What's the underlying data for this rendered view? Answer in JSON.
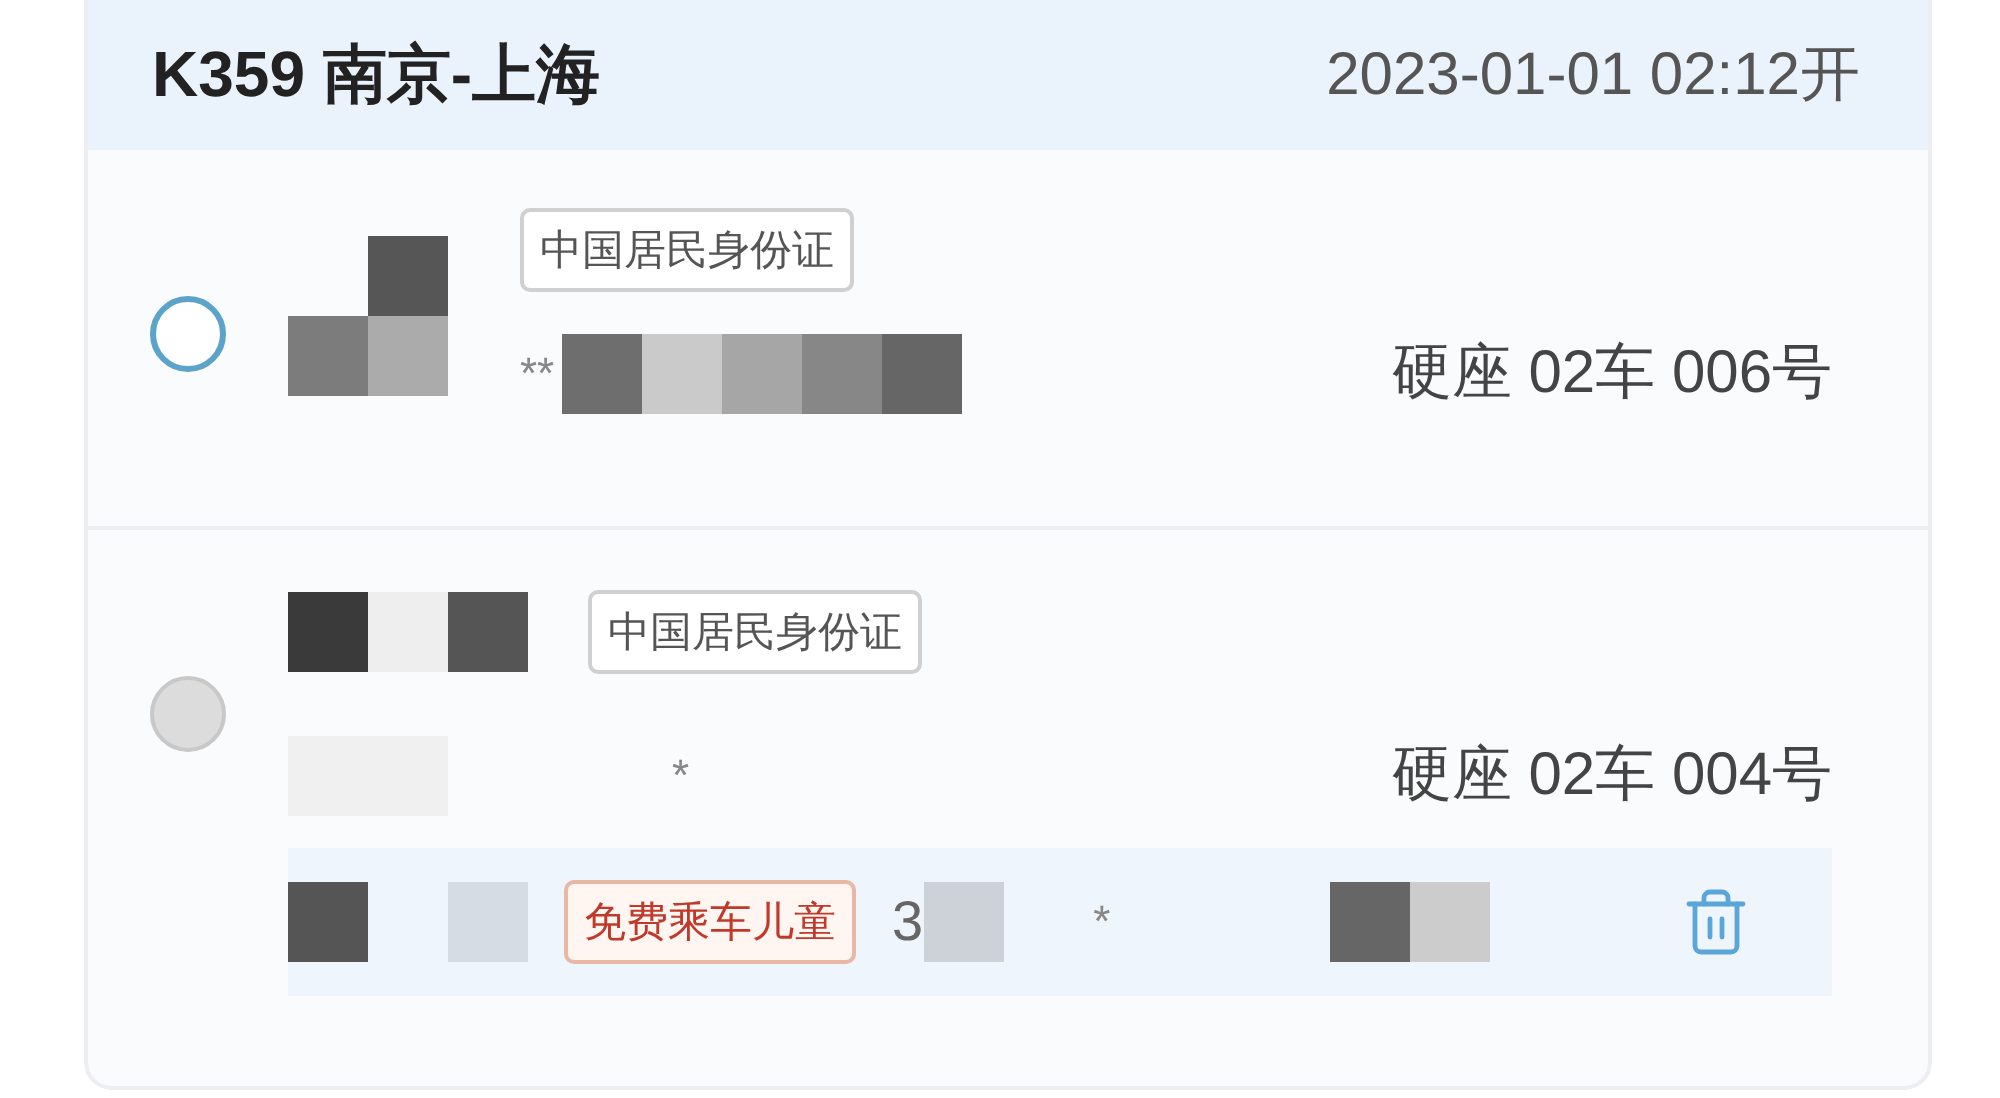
{
  "header": {
    "train": "K359 南京-上海",
    "departure": "2023-01-01 02:12开"
  },
  "passengers": [
    {
      "selected": false,
      "disabled": false,
      "id_type": "中国居民身份证",
      "id_number": "**",
      "seat": "硬座 02车 006号"
    },
    {
      "selected": false,
      "disabled": true,
      "id_type": "中国居民身份证",
      "id_number": "*",
      "seat": "硬座 02车 004号",
      "child": {
        "tag": "免费乘车儿童",
        "age": "3",
        "id_number": "*"
      }
    }
  ]
}
